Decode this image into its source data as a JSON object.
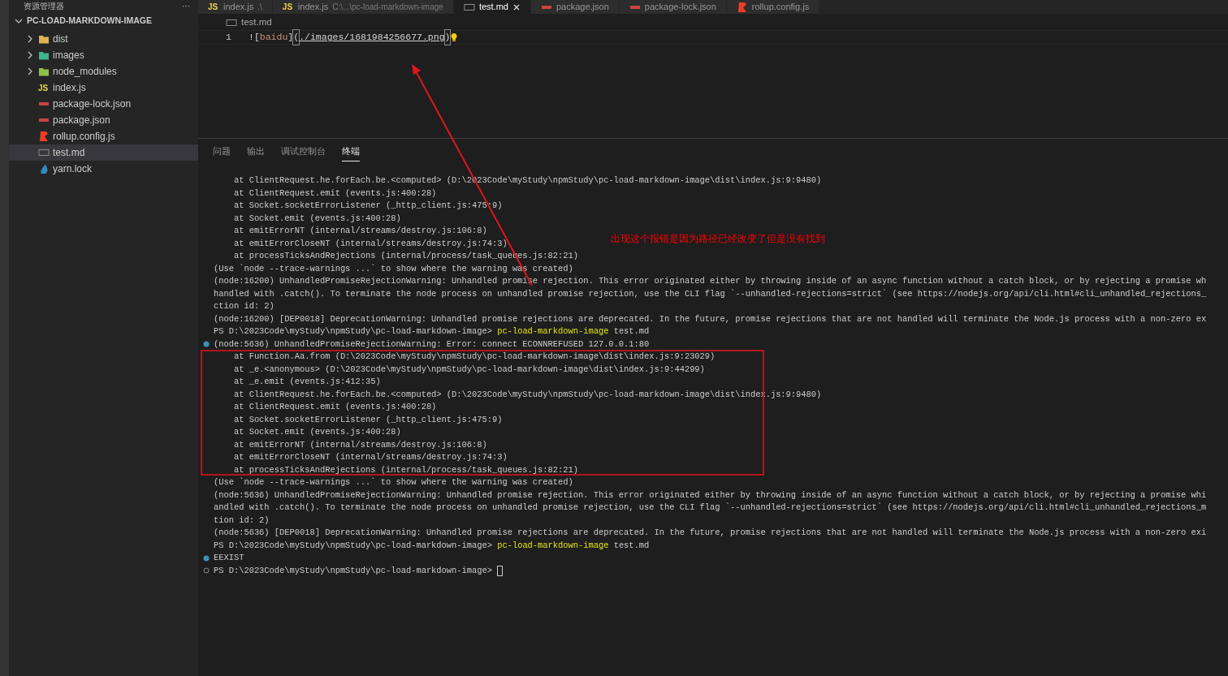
{
  "explorer": {
    "title": "资源管理器",
    "more": "···",
    "project": {
      "name": "PC-LOAD-MARKDOWN-IMAGE",
      "expanded": true
    },
    "items": [
      {
        "label": "dist",
        "kind": "folder",
        "color": "#dcb255",
        "expanded": false,
        "selected": false
      },
      {
        "label": "images",
        "kind": "folder",
        "color": "#3fb68b",
        "expanded": false,
        "selected": false
      },
      {
        "label": "node_modules",
        "kind": "folder",
        "color": "#8bc34a",
        "expanded": false,
        "selected": false
      },
      {
        "label": "index.js",
        "kind": "js",
        "badge": "JS",
        "selected": false
      },
      {
        "label": "package-lock.json",
        "kind": "npm",
        "selected": false
      },
      {
        "label": "package.json",
        "kind": "npm",
        "selected": false
      },
      {
        "label": "rollup.config.js",
        "kind": "rollup",
        "selected": false
      },
      {
        "label": "test.md",
        "kind": "md",
        "selected": true
      },
      {
        "label": "yarn.lock",
        "kind": "yarn",
        "selected": false
      }
    ]
  },
  "tabs": [
    {
      "label": "index.js",
      "description": ".\\",
      "kind": "js",
      "badge": "JS",
      "selected": false
    },
    {
      "label": "index.js",
      "description": "C:\\...\\pc-load-markdown-image",
      "kind": "js",
      "badge": "JS",
      "selected": false
    },
    {
      "label": "test.md",
      "kind": "md",
      "selected": true
    },
    {
      "label": "package.json",
      "kind": "npm",
      "selected": false
    },
    {
      "label": "package-lock.json",
      "kind": "npm",
      "selected": false
    },
    {
      "label": "rollup.config.js",
      "kind": "rollup",
      "selected": false
    }
  ],
  "breadcrumb": {
    "file": "test.md",
    "kind": "md"
  },
  "editor": {
    "lines": [
      {
        "number": "1",
        "lightbulb": true,
        "segments": [
          {
            "text": "![",
            "kind": "punct"
          },
          {
            "text": "baidu",
            "kind": "alt"
          },
          {
            "text": "]",
            "kind": "punct"
          },
          {
            "text": "(",
            "kind": "bracket"
          },
          {
            "text": "./images/1681984256677.png",
            "kind": "link"
          },
          {
            "text": ")",
            "kind": "bracket"
          }
        ]
      }
    ]
  },
  "panel": {
    "tabs": [
      {
        "label": "问题",
        "selected": false
      },
      {
        "label": "输出",
        "selected": false
      },
      {
        "label": "调试控制台",
        "selected": false
      },
      {
        "label": "终端",
        "selected": true
      }
    ],
    "terminal": [
      {
        "text": "    at ClientRequest.he.forEach.be.<computed> (D:\\2023Code\\myStudy\\npmStudy\\pc-load-markdown-image\\dist\\index.js:9:9480)"
      },
      {
        "text": "    at ClientRequest.emit (events.js:400:28)"
      },
      {
        "text": "    at Socket.socketErrorListener (_http_client.js:475:9)"
      },
      {
        "text": "    at Socket.emit (events.js:400:28)"
      },
      {
        "text": "    at emitErrorNT (internal/streams/destroy.js:106:8)"
      },
      {
        "text": "    at emitErrorCloseNT (internal/streams/destroy.js:74:3)"
      },
      {
        "text": "    at processTicksAndRejections (internal/process/task_queues.js:82:21)"
      },
      {
        "text": "(Use `node --trace-warnings ...` to show where the warning was created)"
      },
      {
        "text": "(node:16200) UnhandledPromiseRejectionWarning: Unhandled promise rejection. This error originated either by throwing inside of an async function without a catch block, or by rejecting a promise wh"
      },
      {
        "text": "handled with .catch(). To terminate the node process on unhandled promise rejection, use the CLI flag `--unhandled-rejections=strict` (see https://nodejs.org/api/cli.html#cli_unhandled_rejections_"
      },
      {
        "text": "ction id: 2)"
      },
      {
        "text": "(node:16200) [DEP0018] DeprecationWarning: Unhandled promise rejections are deprecated. In the future, promise rejections that are not handled will terminate the Node.js process with a non-zero ex"
      },
      {
        "prompt": "PS D:\\2023Code\\myStudy\\npmStudy\\pc-load-markdown-image>",
        "command": "pc-load-markdown-image",
        "args": "test.md"
      },
      {
        "kind": "filled",
        "text": "(node:5636) UnhandledPromiseRejectionWarning: Error: connect ECONNREFUSED 127.0.0.1:80"
      },
      {
        "text": "    at Function.Aa.from (D:\\2023Code\\myStudy\\npmStudy\\pc-load-markdown-image\\dist\\index.js:9:23029)"
      },
      {
        "text": "    at _e.<anonymous> (D:\\2023Code\\myStudy\\npmStudy\\pc-load-markdown-image\\dist\\index.js:9:44299)"
      },
      {
        "text": "    at _e.emit (events.js:412:35)"
      },
      {
        "text": "    at ClientRequest.he.forEach.be.<computed> (D:\\2023Code\\myStudy\\npmStudy\\pc-load-markdown-image\\dist\\index.js:9:9480)"
      },
      {
        "text": "    at ClientRequest.emit (events.js:400:28)"
      },
      {
        "text": "    at Socket.socketErrorListener (_http_client.js:475:9)"
      },
      {
        "text": "    at Socket.emit (events.js:400:28)"
      },
      {
        "text": "    at emitErrorNT (internal/streams/destroy.js:106:8)"
      },
      {
        "text": "    at emitErrorCloseNT (internal/streams/destroy.js:74:3)"
      },
      {
        "text": "    at processTicksAndRejections (internal/process/task_queues.js:82:21)"
      },
      {
        "text": "(Use `node --trace-warnings ...` to show where the warning was created)"
      },
      {
        "text": "(node:5636) UnhandledPromiseRejectionWarning: Unhandled promise rejection. This error originated either by throwing inside of an async function without a catch block, or by rejecting a promise whi"
      },
      {
        "text": "andled with .catch(). To terminate the node process on unhandled promise rejection, use the CLI flag `--unhandled-rejections=strict` (see https://nodejs.org/api/cli.html#cli_unhandled_rejections_m"
      },
      {
        "text": "tion id: 2)"
      },
      {
        "text": "(node:5636) [DEP0018] DeprecationWarning: Unhandled promise rejections are deprecated. In the future, promise rejections that are not handled will terminate the Node.js process with a non-zero exi"
      },
      {
        "prompt": "PS D:\\2023Code\\myStudy\\npmStudy\\pc-load-markdown-image>",
        "command": "pc-load-markdown-image",
        "args": "test.md"
      },
      {
        "kind": "filled",
        "text": "EEXIST"
      },
      {
        "kind": "hollow",
        "prompt": "PS D:\\2023Code\\myStudy\\npmStudy\\pc-load-markdown-image>",
        "cursor": true
      }
    ]
  },
  "annotation": {
    "note": "出现这个报错是因为路径已经改变了但是没有找到"
  }
}
